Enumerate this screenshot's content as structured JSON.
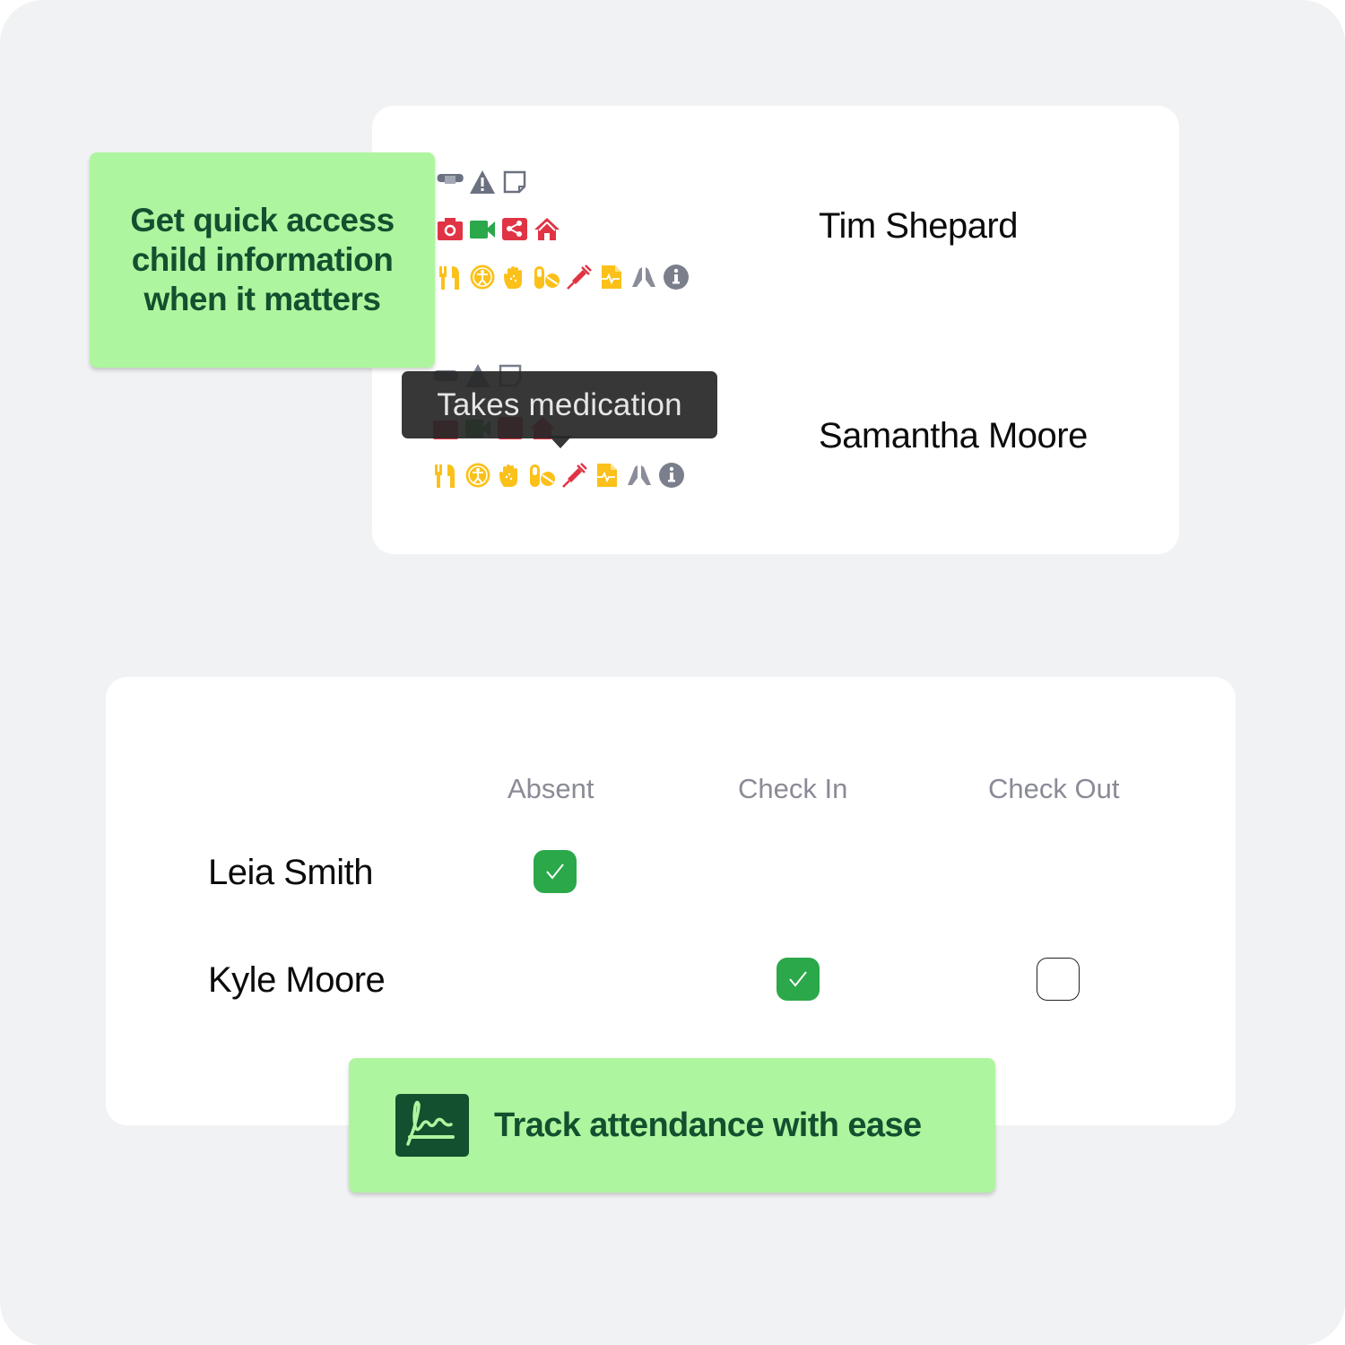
{
  "colors": {
    "background": "#f1f2f4",
    "card": "#ffffff",
    "callout_bg": "#aef59f",
    "callout_text": "#12502f",
    "checked": "#2aa84a",
    "icon_gray": "#6b7180",
    "icon_red": "#e03445",
    "icon_green": "#2aa84a",
    "icon_yellow": "#fbc11a",
    "header_gray": "#8a8b96"
  },
  "info_panel": {
    "callout": "Get quick access child information when it matters",
    "tooltip": "Takes medication",
    "children": [
      {
        "name": "Tim Shepard",
        "icon_rows": [
          [
            "bandage-icon",
            "warning-icon",
            "note-icon"
          ],
          [
            "camera-icon",
            "video-icon",
            "share-icon",
            "home-icon"
          ],
          [
            "food-icon",
            "disability-icon",
            "allergy-hand-icon",
            "medication-icon",
            "syringe-icon",
            "medical-document-icon",
            "praying-hands-icon",
            "info-icon"
          ]
        ]
      },
      {
        "name": "Samantha Moore",
        "icon_rows": [
          [
            "bandage-icon",
            "warning-icon",
            "note-icon"
          ],
          [
            "camera-icon",
            "video-icon",
            "share-icon",
            "home-icon"
          ],
          [
            "food-icon",
            "disability-icon",
            "allergy-hand-icon",
            "medication-icon",
            "syringe-icon",
            "medical-document-icon",
            "praying-hands-icon",
            "info-icon"
          ]
        ]
      }
    ]
  },
  "attendance": {
    "columns": [
      "Absent",
      "Check In",
      "Check Out"
    ],
    "rows": [
      {
        "name": "Leia Smith",
        "absent": true,
        "check_in": null,
        "check_out": null
      },
      {
        "name": "Kyle Moore",
        "absent": null,
        "check_in": true,
        "check_out": false
      }
    ],
    "callout": "Track attendance with ease",
    "callout_icon": "signature-icon"
  }
}
